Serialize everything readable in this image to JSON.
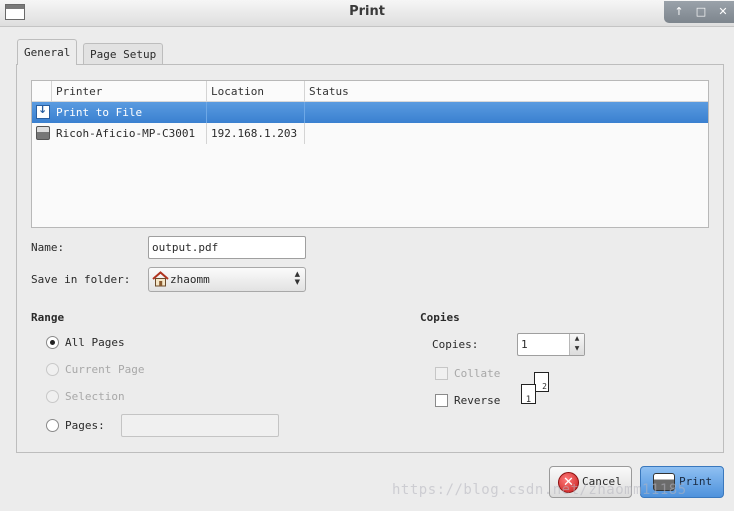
{
  "window": {
    "title": "Print"
  },
  "tabs": [
    {
      "label": "General",
      "active": true
    },
    {
      "label": "Page Setup",
      "active": false
    }
  ],
  "printer_list": {
    "columns": [
      "Printer",
      "Location",
      "Status"
    ],
    "rows": [
      {
        "icon": "print-to-file-icon",
        "printer": "Print to File",
        "location": "",
        "status": "",
        "selected": true
      },
      {
        "icon": "printer-icon",
        "printer": "Ricoh-Aficio-MP-C3001",
        "location": "192.168.1.203",
        "status": "",
        "selected": false
      }
    ]
  },
  "form": {
    "name_label": "Name:",
    "name_value": "output.pdf",
    "folder_label": "Save in folder:",
    "folder_value": "zhaomm"
  },
  "range": {
    "title": "Range",
    "all_pages": "All Pages",
    "current_page": "Current Page",
    "selection": "Selection",
    "pages": "Pages:",
    "pages_value": "",
    "selected_option": "all_pages"
  },
  "copies": {
    "title": "Copies",
    "copies_label": "Copies:",
    "copies_value": "1",
    "collate_label": "Collate",
    "collate_checked": false,
    "collate_enabled": false,
    "reverse_label": "Reverse",
    "reverse_checked": false,
    "preview_front": "1",
    "preview_back": "2"
  },
  "buttons": {
    "cancel": "Cancel",
    "print": "Print"
  },
  "watermark": "https://blog.csdn.net/zhaomm11185",
  "colors": {
    "selection": "#3a80d0",
    "cancel": "#c61c1c",
    "print": "#4e92dc"
  }
}
